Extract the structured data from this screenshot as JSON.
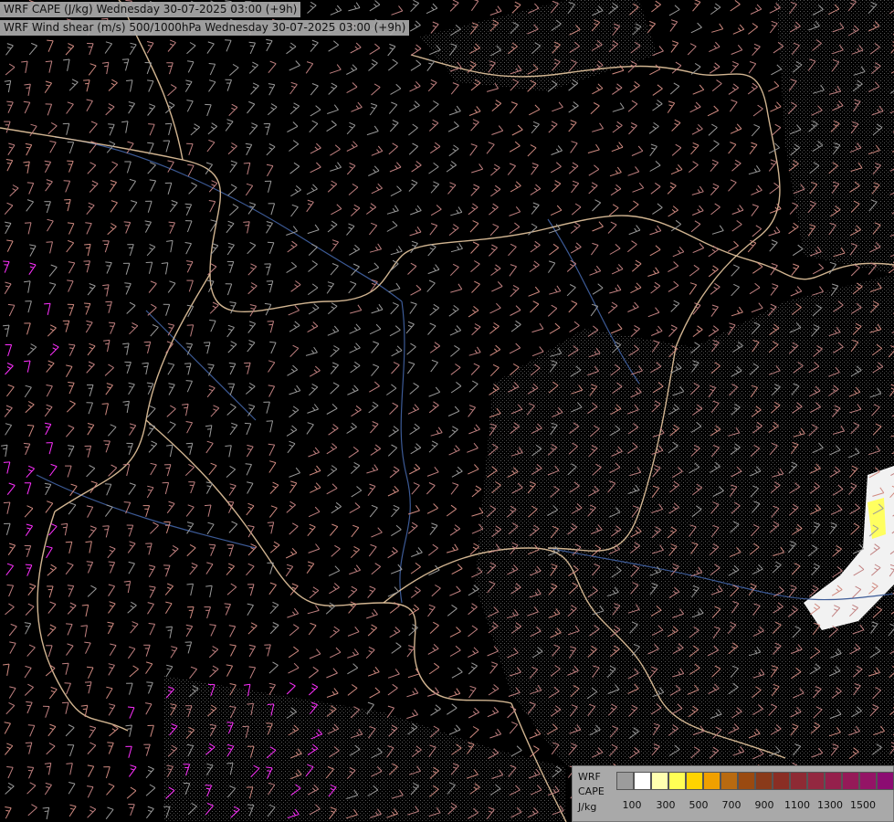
{
  "titles": {
    "line1": "WRF CAPE (J/kg) Wednesday 30-07-2025 03:00 (+9h)",
    "line2": "WRF Wind shear (m/s) 500/1000hPa Wednesday 30-07-2025 03:00 (+9h)"
  },
  "legend": {
    "name_line1": "WRF",
    "name_line2": "CAPE",
    "unit": "J/kg",
    "swatch_colors": [
      "#9c9c9c",
      "#ffffff",
      "#ffffb0",
      "#ffff55",
      "#ffd400",
      "#f0a000",
      "#b86a10",
      "#9a4a10",
      "#8a3a1a",
      "#8a2e24",
      "#8e2a34",
      "#932840",
      "#95204c",
      "#951a58",
      "#941466",
      "#8c0c72",
      "#86007c"
    ],
    "ticks": [
      "100",
      "300",
      "500",
      "700",
      "900",
      "1100",
      "1300",
      "1500"
    ]
  },
  "map": {
    "background_color": "#000000",
    "border_color": "#e8c8a0",
    "river_color": "#3c5a96",
    "barb_colors": [
      "#9a9a9a",
      "#c08080",
      "#d08a80",
      "#e0408a",
      "#ff30ff"
    ]
  }
}
